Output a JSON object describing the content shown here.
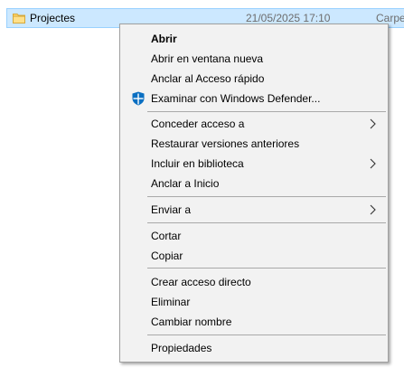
{
  "file": {
    "name": "Projectes",
    "modified": "21/05/2025 17:10",
    "type": "Carpe",
    "icon": "folder-icon"
  },
  "menu": {
    "items": [
      {
        "label": "Abrir",
        "bold": true
      },
      {
        "label": "Abrir en ventana nueva"
      },
      {
        "label": "Anclar al Acceso rápido"
      },
      {
        "label": "Examinar con Windows Defender...",
        "icon": "windows-defender-icon"
      },
      {
        "label": "Conceder acceso a",
        "submenu": true
      },
      {
        "label": "Restaurar versiones anteriores"
      },
      {
        "label": "Incluir en biblioteca",
        "submenu": true
      },
      {
        "label": "Anclar a Inicio"
      },
      {
        "label": "Enviar a",
        "submenu": true
      },
      {
        "label": "Cortar"
      },
      {
        "label": "Copiar"
      },
      {
        "label": "Crear acceso directo"
      },
      {
        "label": "Eliminar"
      },
      {
        "label": "Cambiar nombre"
      },
      {
        "label": "Propiedades"
      }
    ]
  },
  "colors": {
    "selection_bg": "#cce8ff",
    "selection_border": "#99d1ff",
    "menu_bg": "#f2f2f2",
    "menu_border": "#a0a0a0",
    "separator": "#a9a9a9",
    "defender_blue": "#0a6fc2"
  }
}
